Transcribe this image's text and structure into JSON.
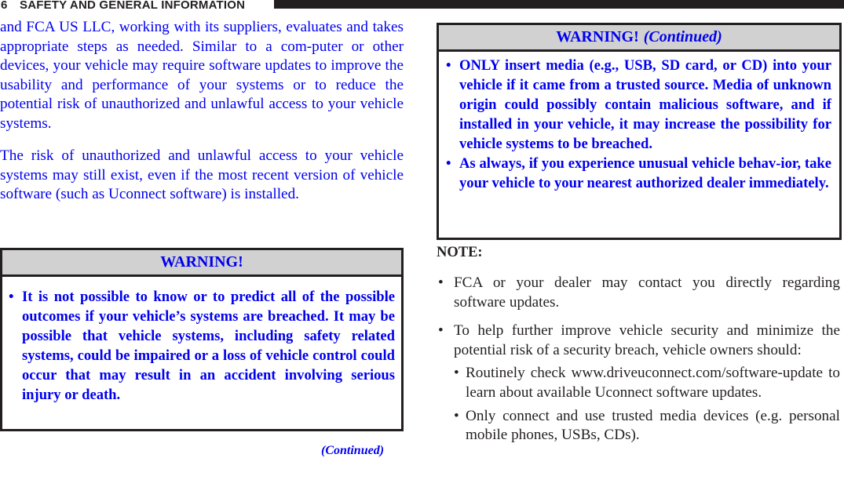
{
  "header": {
    "page_number": "6",
    "section_title": "SAFETY AND GENERAL INFORMATION"
  },
  "left_column": {
    "paragraphs": [
      "and FCA US LLC, working with its suppliers, evaluates and takes appropriate steps as needed. Similar to a com-puter or other devices, your vehicle may require software updates to improve the usability and performance of your systems or to reduce the potential risk of unauthorized and unlawful access to your vehicle systems.",
      "The risk of unauthorized and unlawful access to your vehicle systems may still exist, even if the most recent version of vehicle software (such as Uconnect software) is installed."
    ],
    "warning": {
      "title": "WARNING!",
      "items": [
        "It is not possible to know or to predict all of the possible outcomes if your vehicle’s systems are breached. It may be possible that vehicle systems, including safety related systems, could be impaired or a loss of vehicle control could occur that may result in an accident involving serious injury or death."
      ]
    },
    "continued_label": "(Continued)"
  },
  "right_column": {
    "warning": {
      "title": "WARNING!",
      "title_suffix": "(Continued)",
      "items": [
        "ONLY insert media (e.g., USB, SD card, or CD) into your vehicle if it came from a trusted source. Media of unknown origin could possibly contain malicious software, and if installed in your vehicle, it may increase the possibility for vehicle systems to be breached.",
        "As always, if you experience unusual vehicle behav-ior, take your vehicle to your nearest authorized dealer immediately."
      ]
    },
    "note": {
      "title": "NOTE:",
      "items": [
        "FCA or your dealer may contact you directly regarding software updates.",
        "To help further improve vehicle security and minimize the potential risk of a security breach, vehicle owners should:"
      ],
      "sub_items": [
        "Routinely check www.driveuconnect.com/software-update to learn about available Uconnect software updates.",
        "Only connect and use trusted media devices (e.g. personal mobile phones, USBs, CDs)."
      ]
    }
  },
  "bullet_glyph": "•",
  "colors": {
    "text_blue": "#0000ee",
    "text_dark": "#231f20",
    "warning_header_bg": "#d1d1d1"
  }
}
